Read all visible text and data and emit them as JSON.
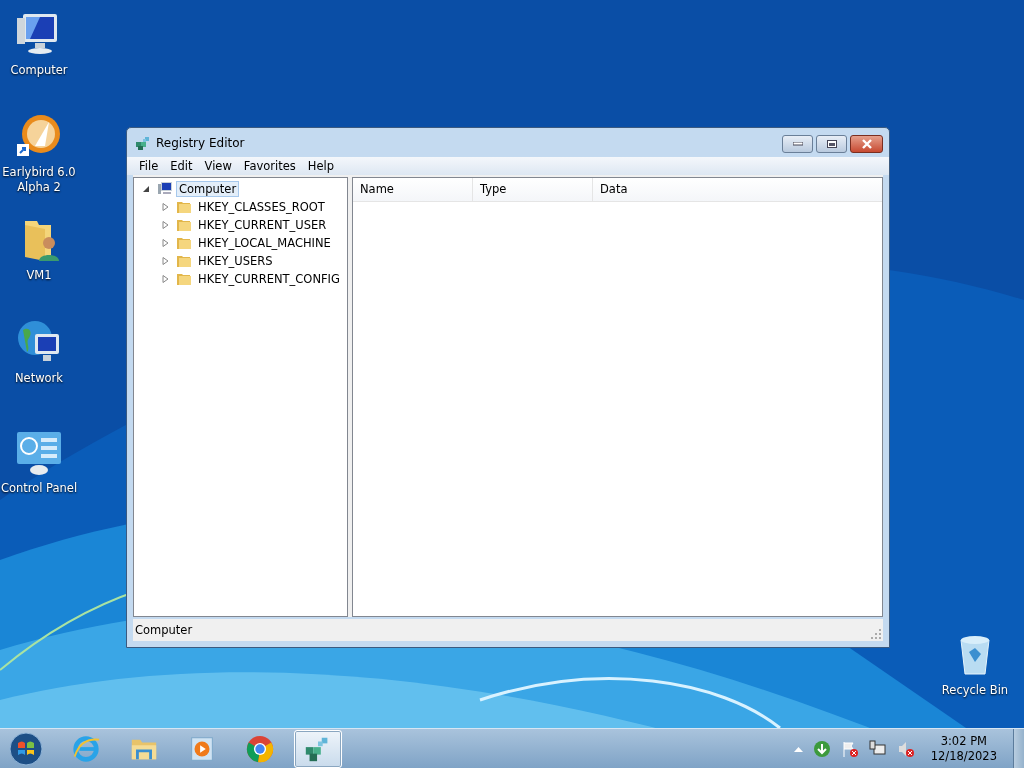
{
  "desktop_icons": [
    {
      "kind": "computer",
      "label": "Computer"
    },
    {
      "kind": "app",
      "label": "Earlybird 6.0 Alpha 2"
    },
    {
      "kind": "user-folder",
      "label": "VM1"
    },
    {
      "kind": "network",
      "label": "Network"
    },
    {
      "kind": "control-panel",
      "label": "Control Panel"
    },
    {
      "kind": "recycle-bin",
      "label": "Recycle Bin"
    }
  ],
  "window": {
    "title": "Registry Editor",
    "menu": [
      "File",
      "Edit",
      "View",
      "Favorites",
      "Help"
    ],
    "tree": [
      {
        "label": "Computer",
        "expanded": true,
        "selected": true,
        "children": [
          {
            "label": "HKEY_CLASSES_ROOT",
            "expanded": false,
            "selected": false
          },
          {
            "label": "HKEY_CURRENT_USER",
            "expanded": false,
            "selected": false
          },
          {
            "label": "HKEY_LOCAL_MACHINE",
            "expanded": false,
            "selected": false
          },
          {
            "label": "HKEY_USERS",
            "expanded": false,
            "selected": false
          },
          {
            "label": "HKEY_CURRENT_CONFIG",
            "expanded": false,
            "selected": false
          }
        ]
      }
    ],
    "columns": [
      "Name",
      "Type",
      "Data"
    ],
    "status_bar": "Computer"
  },
  "taskbar": {
    "items": [
      {
        "kind": "browser-e",
        "active": false
      },
      {
        "kind": "folder",
        "active": false
      },
      {
        "kind": "media",
        "active": false
      },
      {
        "kind": "chrome",
        "active": false
      },
      {
        "kind": "registry",
        "active": true
      }
    ],
    "tray": {
      "time": "3:02 PM",
      "date": "12/18/2023"
    }
  }
}
